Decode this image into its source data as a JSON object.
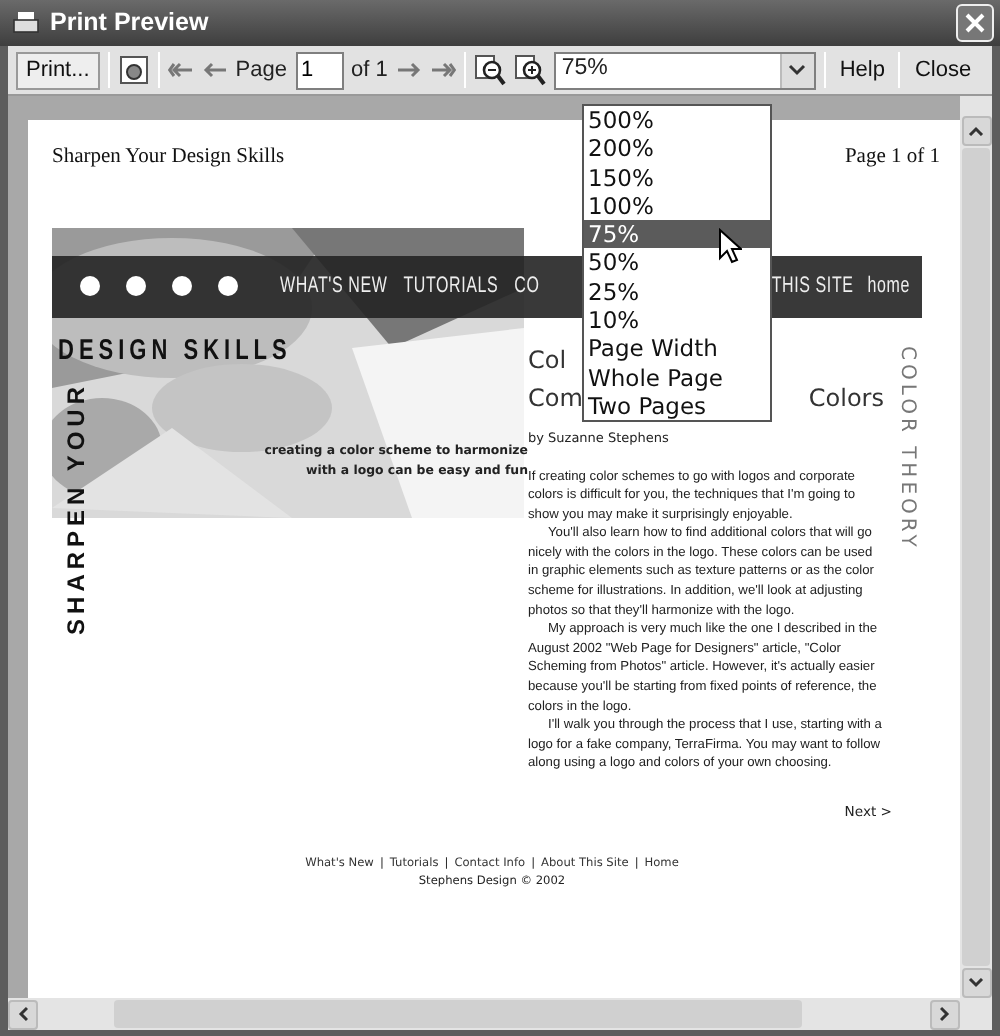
{
  "window": {
    "title": "Print Preview"
  },
  "toolbar": {
    "print_button": "Print...",
    "page_label": "Page",
    "page_value": "1",
    "page_count": "of 1",
    "zoom_value": "75%",
    "help_button": "Help",
    "close_button": "Close"
  },
  "zoom_menu": {
    "items": [
      {
        "label": "500%",
        "selected": false
      },
      {
        "label": "200%",
        "selected": false
      },
      {
        "label": "150%",
        "selected": false
      },
      {
        "label": "100%",
        "selected": false
      },
      {
        "label": "75%",
        "selected": true
      },
      {
        "label": "50%",
        "selected": false
      },
      {
        "label": "25%",
        "selected": false
      },
      {
        "label": "10%",
        "selected": false
      },
      {
        "label": "Page Width",
        "selected": false
      },
      {
        "label": "Whole Page",
        "selected": false
      },
      {
        "label": "Two Pages",
        "selected": false
      }
    ]
  },
  "page": {
    "header_left": "Sharpen Your Design Skills",
    "header_right": "Page 1 of 1",
    "site": {
      "nav_left": [
        "WHAT'S NEW",
        "TUTORIALS",
        "CO"
      ],
      "nav_right": [
        "THIS SITE",
        "home"
      ],
      "logo_top": "DESIGN SKILLS",
      "logo_side": "SHARPEN YOUR",
      "tagline": "creating a color scheme to harmonize with a logo can be easy and fun",
      "title_line_1": "Col",
      "title_line_2_start": "Com",
      "title_line_2_end": "Colors",
      "section": "COLOR THEORY",
      "byline": "by Suzanne Stephens",
      "paragraphs": [
        "If creating color schemes to go with logos and corporate colors is difficult for you, the techniques that I'm going to show you may make it surprisingly enjoyable.",
        "You'll also learn how to find additional colors that will go nicely with the colors in the logo. These colors can be used in graphic elements such as texture patterns or as the color scheme for illustrations. In addition, we'll look at adjusting photos so that they'll harmonize with the logo.",
        "My approach is very much like the one I described in the August 2002 \"Web Page for Designers\" article, \"Color Scheming from Photos\" article. However, it's actually easier because you'll be starting from fixed points of reference, the colors in the logo.",
        "I'll walk you through the process that I use, starting with a logo for a fake company, TerraFirma. You may want to follow along using a logo and colors of your own choosing."
      ],
      "next": "Next >",
      "footer_items": [
        {
          "kind": "link",
          "text": "What's New"
        },
        {
          "kind": "separator",
          "text": "|"
        },
        {
          "kind": "link",
          "text": "Tutorials"
        },
        {
          "kind": "separator",
          "text": "|"
        },
        {
          "kind": "link",
          "text": "Contact Info"
        },
        {
          "kind": "separator",
          "text": "|"
        },
        {
          "kind": "link",
          "text": "About This Site"
        },
        {
          "kind": "separator",
          "text": "|"
        },
        {
          "kind": "link",
          "text": "Home"
        }
      ],
      "copyright": "Stephens Design © 2002"
    }
  }
}
